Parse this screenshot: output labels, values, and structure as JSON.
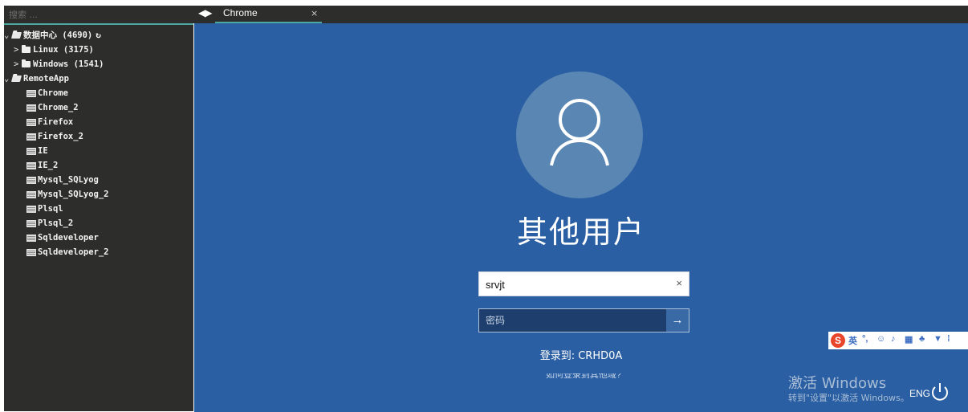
{
  "sidebar": {
    "search_placeholder": "搜索 ...",
    "tree": [
      {
        "caret": "⌄",
        "label": "数据中心 (4690)",
        "kind": "folder-open",
        "refresh": "↻"
      },
      {
        "caret": ">",
        "label": "Linux (3175)",
        "kind": "folder"
      },
      {
        "caret": ">",
        "label": "Windows (1541)",
        "kind": "folder"
      },
      {
        "caret": "⌄",
        "label": "RemoteApp",
        "kind": "folder-open"
      },
      {
        "label": "Chrome",
        "kind": "app"
      },
      {
        "label": "Chrome_2",
        "kind": "app"
      },
      {
        "label": "Firefox",
        "kind": "app"
      },
      {
        "label": "Firefox_2",
        "kind": "app"
      },
      {
        "label": "IE",
        "kind": "app"
      },
      {
        "label": "IE_2",
        "kind": "app"
      },
      {
        "label": "Mysql_SQLyog",
        "kind": "app"
      },
      {
        "label": "Mysql_SQLyog_2",
        "kind": "app"
      },
      {
        "label": "Plsql",
        "kind": "app"
      },
      {
        "label": "Plsql_2",
        "kind": "app"
      },
      {
        "label": "Sqldeveloper",
        "kind": "app"
      },
      {
        "label": "Sqldeveloper_2",
        "kind": "app"
      }
    ]
  },
  "tabbar": {
    "nav_label": "◀▶",
    "tab_label": "Chrome",
    "close_label": "×"
  },
  "login": {
    "title": "其他用户",
    "username_value": "srvjt",
    "clear_label": "×",
    "password_placeholder": "密码",
    "submit_label": "→",
    "login_to": "登录到: CRHD0A",
    "forgot_text": "如何登录到其他域?"
  },
  "ime": {
    "logo": "S",
    "lang_label": "英"
  },
  "watermark": {
    "line1": "激活 Windows",
    "line2": "转到\"设置\"以激活 Windows。"
  },
  "taskbar": {
    "lang": "ENG"
  },
  "colors": {
    "desktop": "#2a5fa3",
    "sidebar": "#2d2d2b",
    "accent": "#4aa8a0"
  }
}
